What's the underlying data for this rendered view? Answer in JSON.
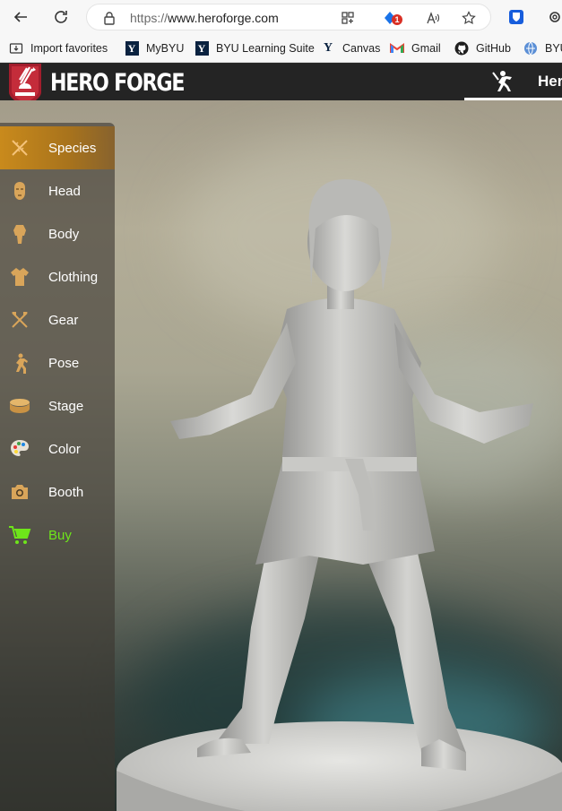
{
  "browser": {
    "url_protocol": "https://",
    "url_host": "www.heroforge.com",
    "extension_badge_count": "1",
    "bookmarks": [
      {
        "label": "Import favorites",
        "icon": "import-icon"
      },
      {
        "label": "MyBYU",
        "icon": "byu-logo"
      },
      {
        "label": "BYU Learning Suite",
        "icon": "byu-logo"
      },
      {
        "label": "Canvas",
        "icon": "byu-y-icon"
      },
      {
        "label": "Gmail",
        "icon": "gmail-icon"
      },
      {
        "label": "GitHub",
        "icon": "github-icon"
      },
      {
        "label": "BYU",
        "icon": "byu-globe-icon"
      }
    ]
  },
  "site": {
    "brand": "HERO FORGE",
    "hero_tab_label": "Her",
    "accent_color": "#c98a1c",
    "buy_color": "#6ee61a"
  },
  "menu": {
    "items": [
      {
        "label": "Species",
        "icon": "dna-icon",
        "active": true
      },
      {
        "label": "Head",
        "icon": "head-icon"
      },
      {
        "label": "Body",
        "icon": "body-icon"
      },
      {
        "label": "Clothing",
        "icon": "shirt-icon"
      },
      {
        "label": "Gear",
        "icon": "crossed-axes-icon"
      },
      {
        "label": "Pose",
        "icon": "pose-icon"
      },
      {
        "label": "Stage",
        "icon": "stage-icon"
      },
      {
        "label": "Color",
        "icon": "palette-icon"
      },
      {
        "label": "Booth",
        "icon": "camera-icon"
      },
      {
        "label": "Buy",
        "icon": "cart-icon"
      }
    ]
  }
}
